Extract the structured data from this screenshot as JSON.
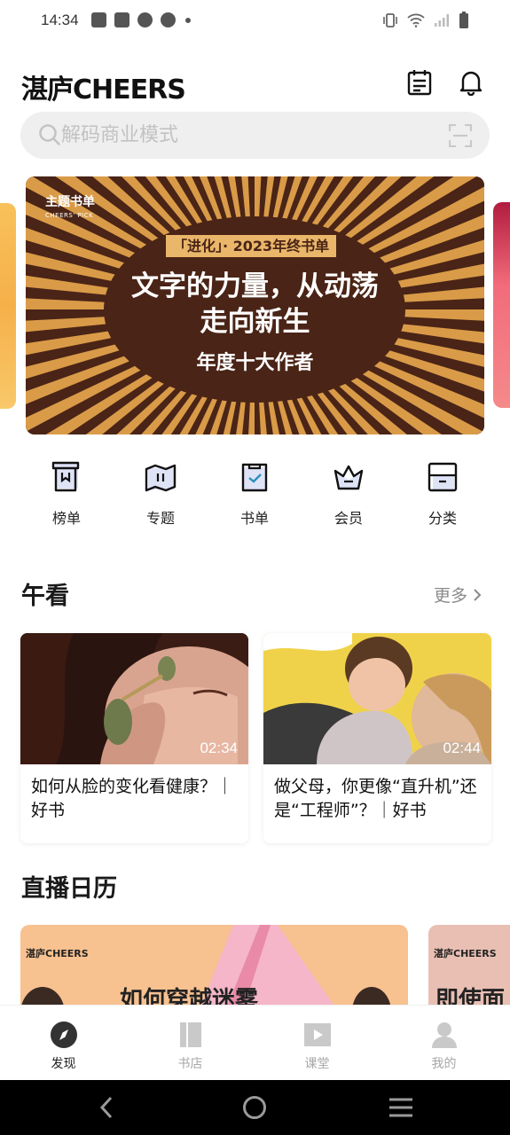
{
  "status_bar": {
    "time": "14:34"
  },
  "header": {
    "logo_text": "湛庐CHEERS"
  },
  "search": {
    "placeholder": "解码商业模式"
  },
  "banner": {
    "tag_cn": "主题书单",
    "tag_en": "CHEERS' PICK",
    "label": "「进化」· 2023年终书单",
    "title_line1": "文字的力量，从动荡",
    "title_line2": "走向新生",
    "subtitle": "年度十大作者",
    "colors": {
      "bg": "#4a2416",
      "accent": "#e9b66a"
    }
  },
  "quick_nav": [
    {
      "label": "榜单",
      "icon": "ranking-icon"
    },
    {
      "label": "专题",
      "icon": "map-book-icon"
    },
    {
      "label": "书单",
      "icon": "clipboard-check-icon"
    },
    {
      "label": "会员",
      "icon": "crown-icon"
    },
    {
      "label": "分类",
      "icon": "category-box-icon"
    }
  ],
  "section_watch": {
    "title": "午看",
    "more": "更多",
    "videos": [
      {
        "duration": "02:34",
        "title": "如何从脸的变化看健康？｜好书"
      },
      {
        "duration": "02:44",
        "title": "做父母，你更像“直升机”还是“工程师”？｜好书"
      }
    ]
  },
  "section_live": {
    "title": "直播日历",
    "cards": [
      {
        "logo": "湛庐CHEERS",
        "headline": "如何穿越迷雾"
      },
      {
        "logo": "湛庐CHEERS",
        "headline": "即使面"
      }
    ]
  },
  "tab_bar": [
    {
      "label": "发现",
      "icon": "compass-icon",
      "active": true
    },
    {
      "label": "书店",
      "icon": "books-icon",
      "active": false
    },
    {
      "label": "课堂",
      "icon": "play-icon",
      "active": false
    },
    {
      "label": "我的",
      "icon": "user-icon",
      "active": false
    }
  ]
}
